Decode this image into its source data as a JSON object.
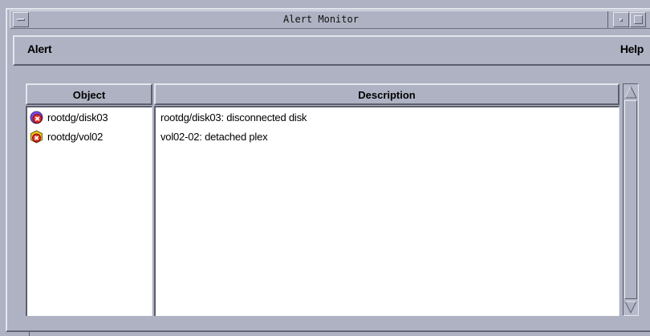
{
  "window": {
    "title": "Alert Monitor"
  },
  "menubar": {
    "alert_label": "Alert",
    "help_label": "Help"
  },
  "table": {
    "columns": [
      "Object",
      "Description"
    ],
    "rows": [
      {
        "icon": "disk-alert-icon",
        "object": "rootdg/disk03",
        "description": "rootdg/disk03: disconnected disk"
      },
      {
        "icon": "volume-alert-icon",
        "object": "rootdg/vol02",
        "description": "vol02-02: detached plex"
      }
    ]
  },
  "colors": {
    "background": "#aeb2c3",
    "list_background": "#ffffff",
    "alert_red": "#e03028",
    "disk_purple": "#7c4be0",
    "volume_yellow": "#e8c21a"
  }
}
